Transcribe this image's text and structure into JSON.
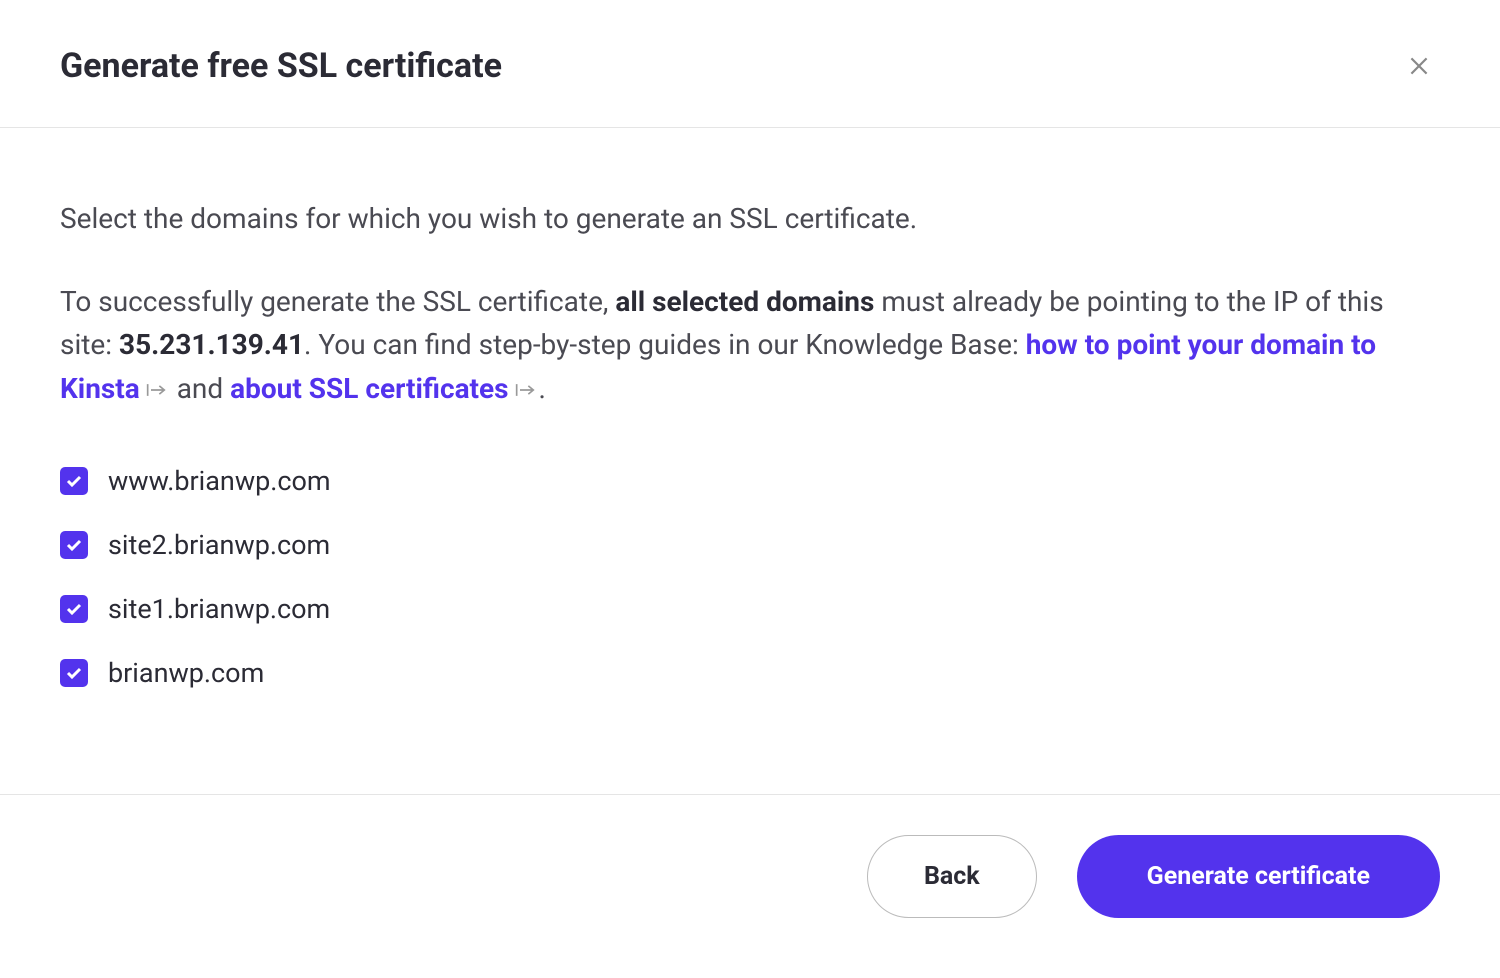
{
  "header": {
    "title": "Generate free SSL certificate"
  },
  "content": {
    "intro": "Select the domains for which you wish to generate an SSL certificate.",
    "instruction_prefix": "To successfully generate the SSL certificate, ",
    "instruction_bold1": "all selected domains",
    "instruction_mid1": " must already be pointing to the IP of this site: ",
    "instruction_bold2": "35.231.139.41",
    "instruction_mid2": ". You can find step-by-step guides in our Knowledge Base: ",
    "link1": "how to point your domain to Kinsta",
    "instruction_and": " and ",
    "link2": "about SSL certificates",
    "instruction_end": "."
  },
  "domains": [
    {
      "name": "www.brianwp.com",
      "checked": true
    },
    {
      "name": "site2.brianwp.com",
      "checked": true
    },
    {
      "name": "site1.brianwp.com",
      "checked": true
    },
    {
      "name": "brianwp.com",
      "checked": true
    }
  ],
  "footer": {
    "back_label": "Back",
    "generate_label": "Generate certificate"
  }
}
